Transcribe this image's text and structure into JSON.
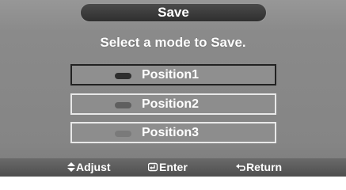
{
  "dialog": {
    "title": "Save",
    "prompt": "Select a mode to Save."
  },
  "options": [
    {
      "label": "Position1",
      "selected": true
    },
    {
      "label": "Position2",
      "selected": false
    },
    {
      "label": "Position3",
      "selected": false
    }
  ],
  "footer": {
    "adjust_label": "Adjust",
    "adjust_icon": "up-down-arrow-icon",
    "enter_label": "Enter",
    "enter_icon": "enter-icon",
    "return_label": "Return",
    "return_icon": "return-icon"
  },
  "colors": {
    "panel": "#8a8a8a",
    "title_bar": "#3a3a3a",
    "selected_border": "#222222",
    "option_border": "#e8e8e8"
  }
}
